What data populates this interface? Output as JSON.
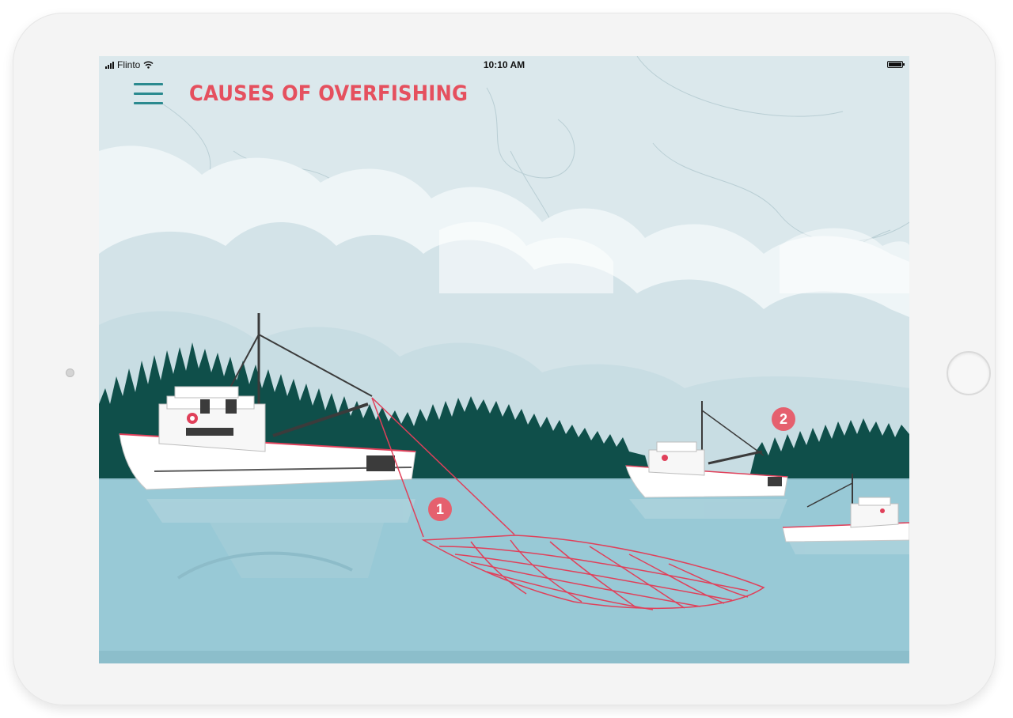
{
  "status_bar": {
    "carrier": "Flinto",
    "time": "10:10 AM",
    "icons": [
      "signal-icon",
      "wifi-icon",
      "battery-icon"
    ]
  },
  "header": {
    "title": "CAUSES OF OVERFISHING",
    "menu_icon": "hamburger-menu-icon"
  },
  "markers": [
    {
      "label": "1"
    },
    {
      "label": "2"
    }
  ],
  "colors": {
    "title": "#e5505e",
    "menu": "#2b8a8f",
    "marker": "#e5606e",
    "net": "#e0405a",
    "forest": "#0f4f4a",
    "sea": "#98c9d6",
    "sky": "#dbe8ec"
  }
}
